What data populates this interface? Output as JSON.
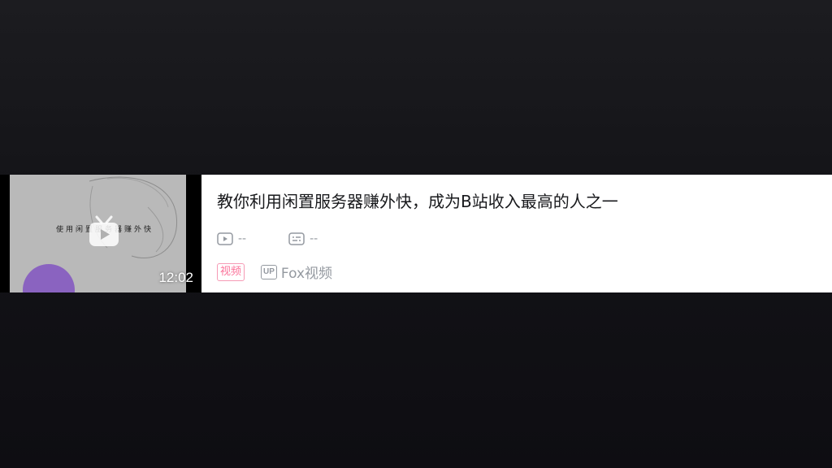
{
  "video": {
    "thumbnail_text": "使用闲置服务器赚外快",
    "duration": "12:02",
    "title": "教你利用闲置服务器赚外快，成为B站收入最高的人之一",
    "play_count": "--",
    "danmaku_count": "--",
    "type_badge": "视频",
    "up_badge": "UP",
    "author": "Fox视频"
  },
  "colors": {
    "badge_pink": "#fb7299",
    "muted_gray": "#9499a0",
    "thumb_purple": "#8a63c0"
  },
  "icons": {
    "thumbnail_play": "bilibili-tv-play-icon",
    "play_count": "play-count-icon",
    "danmaku": "danmaku-icon",
    "up": "up-badge-icon"
  }
}
